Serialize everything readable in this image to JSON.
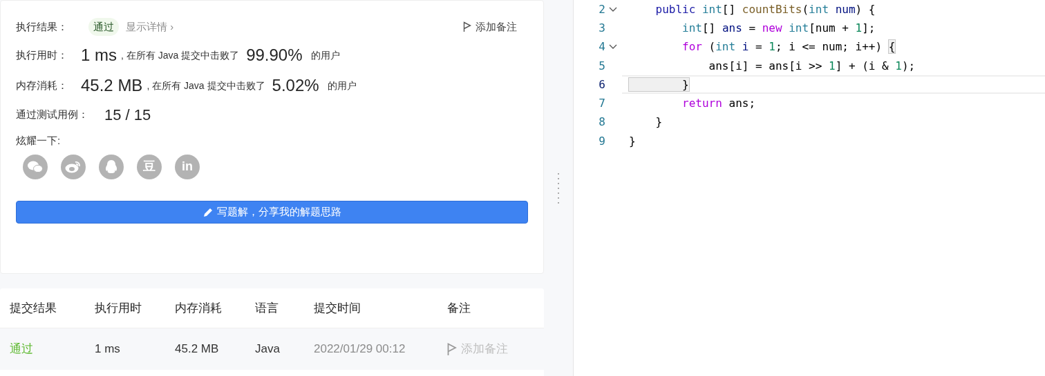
{
  "result_panel": {
    "status_label": "执行结果：",
    "status": "通过",
    "details_link": "显示详情 ›",
    "add_note": "添加备注",
    "stats": [
      {
        "label": "执行用时：",
        "value": "1 ms",
        "middle": ", 在所有 Java 提交中击败了",
        "percent": "99.90%",
        "suffix": "的用户"
      },
      {
        "label": "内存消耗：",
        "value": "45.2 MB",
        "middle": ", 在所有 Java 提交中击败了",
        "percent": "5.02%",
        "suffix": "的用户"
      }
    ],
    "tests_label": "通过测试用例：",
    "tests_value": "15 / 15",
    "share_label": "炫耀一下:",
    "share_buttons": [
      {
        "kind": "chat"
      },
      {
        "kind": "swirl"
      },
      {
        "kind": "penguin"
      },
      {
        "kind": "glyph",
        "glyph": "豆"
      },
      {
        "kind": "glyph",
        "glyph": "in"
      }
    ],
    "write_button": "写题解，分享我的解题思路"
  },
  "submissions": {
    "columns": [
      "提交结果",
      "执行用时",
      "内存消耗",
      "语言",
      "提交时间",
      "备注"
    ],
    "rows": [
      {
        "result": "通过",
        "runtime": "1 ms",
        "memory": "45.2 MB",
        "language": "Java",
        "time": "2022/01/29 00:12",
        "note": "添加备注"
      }
    ]
  },
  "editor": {
    "lines": [
      {
        "number": "2",
        "foldable": true,
        "active": false,
        "tokens": [
          {
            "kind": "keyword",
            "text": "    public"
          },
          {
            "kind": "type",
            "text": " int"
          },
          {
            "kind": "plain",
            "text": "[] "
          },
          {
            "kind": "function",
            "text": "countBits"
          },
          {
            "kind": "plain",
            "text": "("
          },
          {
            "kind": "type",
            "text": "int"
          },
          {
            "kind": "variable",
            "text": " num"
          },
          {
            "kind": "plain",
            "text": ") {"
          }
        ]
      },
      {
        "number": "3",
        "foldable": false,
        "active": false,
        "tokens": [
          {
            "kind": "type",
            "text": "        int"
          },
          {
            "kind": "plain",
            "text": "[] "
          },
          {
            "kind": "variable",
            "text": "ans"
          },
          {
            "kind": "plain",
            "text": " = "
          },
          {
            "kind": "control",
            "text": "new"
          },
          {
            "kind": "type",
            "text": " int"
          },
          {
            "kind": "plain",
            "text": "[num + "
          },
          {
            "kind": "number",
            "text": "1"
          },
          {
            "kind": "plain",
            "text": "];"
          }
        ]
      },
      {
        "number": "4",
        "foldable": true,
        "active": false,
        "tokens": [
          {
            "kind": "control",
            "text": "        for"
          },
          {
            "kind": "plain",
            "text": " ("
          },
          {
            "kind": "type",
            "text": "int"
          },
          {
            "kind": "variable",
            "text": " i"
          },
          {
            "kind": "plain",
            "text": " = "
          },
          {
            "kind": "number",
            "text": "1"
          },
          {
            "kind": "plain",
            "text": "; i <= num; i++) "
          },
          {
            "kind": "bracket",
            "text": "{"
          }
        ]
      },
      {
        "number": "5",
        "foldable": false,
        "active": false,
        "tokens": [
          {
            "kind": "plain",
            "text": "            ans[i] = ans[i >> "
          },
          {
            "kind": "number",
            "text": "1"
          },
          {
            "kind": "plain",
            "text": "] + (i & "
          },
          {
            "kind": "number",
            "text": "1"
          },
          {
            "kind": "plain",
            "text": ");"
          }
        ]
      },
      {
        "number": "6",
        "foldable": false,
        "active": true,
        "tokens": [
          {
            "kind": "bracket",
            "text": "        }"
          }
        ]
      },
      {
        "number": "7",
        "foldable": false,
        "active": false,
        "tokens": [
          {
            "kind": "control",
            "text": "        return"
          },
          {
            "kind": "plain",
            "text": " ans;"
          }
        ]
      },
      {
        "number": "8",
        "foldable": false,
        "active": false,
        "tokens": [
          {
            "kind": "plain",
            "text": "    }"
          }
        ]
      },
      {
        "number": "9",
        "foldable": false,
        "active": false,
        "tokens": [
          {
            "kind": "plain",
            "text": "}"
          }
        ]
      }
    ]
  }
}
